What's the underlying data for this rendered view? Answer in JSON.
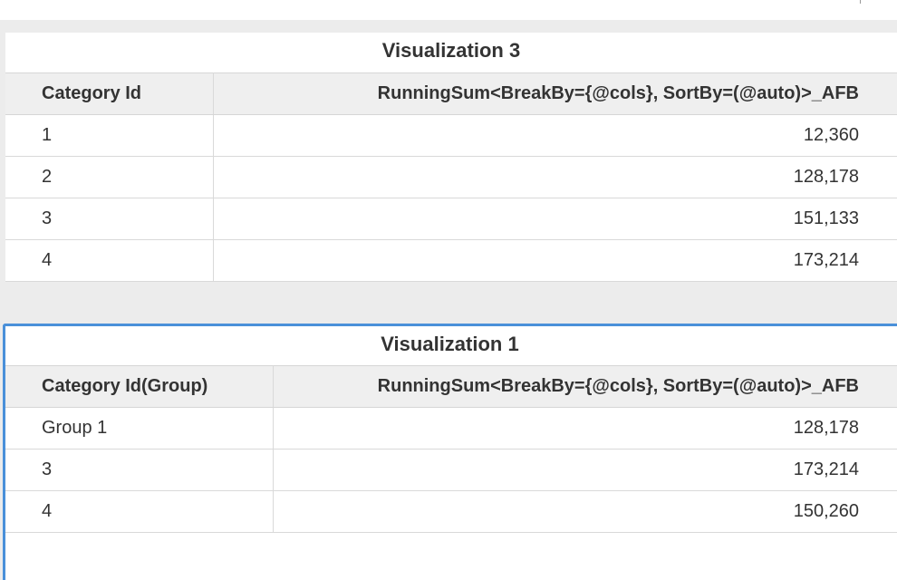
{
  "visualizations": [
    {
      "title": "Visualization 3",
      "columns": [
        "Category Id",
        "RunningSum<BreakBy={@cols}, SortBy=(@auto)>_AFB"
      ],
      "rows": [
        [
          "1",
          "12,360"
        ],
        [
          "2",
          "128,178"
        ],
        [
          "3",
          "151,133"
        ],
        [
          "4",
          "173,214"
        ]
      ]
    },
    {
      "title": "Visualization 1",
      "columns": [
        "Category Id(Group)",
        "RunningSum<BreakBy={@cols}, SortBy=(@auto)>_AFB"
      ],
      "rows": [
        [
          "Group 1",
          "128,178"
        ],
        [
          "3",
          "173,214"
        ],
        [
          "4",
          "150,260"
        ]
      ]
    }
  ],
  "colors": {
    "selected_border": "#4a90d9",
    "header_bg": "#efefef",
    "canvas_bg": "#ececec"
  }
}
